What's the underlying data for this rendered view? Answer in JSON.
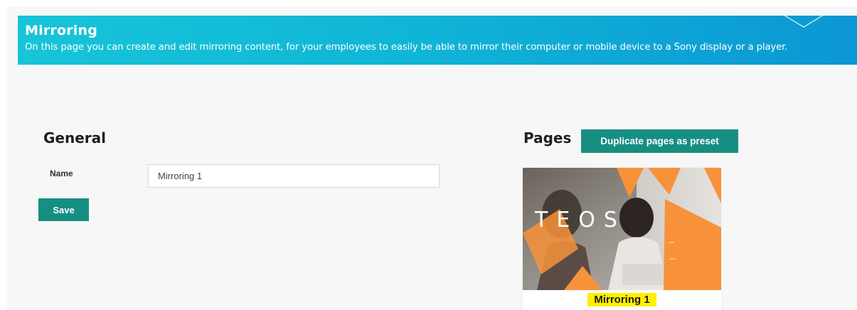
{
  "banner": {
    "title": "Mirroring",
    "description": "On this page you can create and edit mirroring content, for your employees to easily be able to mirror their computer or mobile device to a Sony display or a player.",
    "gradient_start": "#17c4d8",
    "gradient_end": "#0b97d4"
  },
  "general": {
    "title": "General",
    "name_label": "Name",
    "name_value": "Mirroring 1",
    "save_label": "Save"
  },
  "pages": {
    "title": "Pages",
    "duplicate_label": "Duplicate pages as preset",
    "items": [
      {
        "label": "Mirroring 1",
        "thumbnail_text": "TEOS"
      }
    ]
  },
  "colors": {
    "accent": "#178e82",
    "highlight": "#ffef00",
    "orange": "#f7923a"
  }
}
